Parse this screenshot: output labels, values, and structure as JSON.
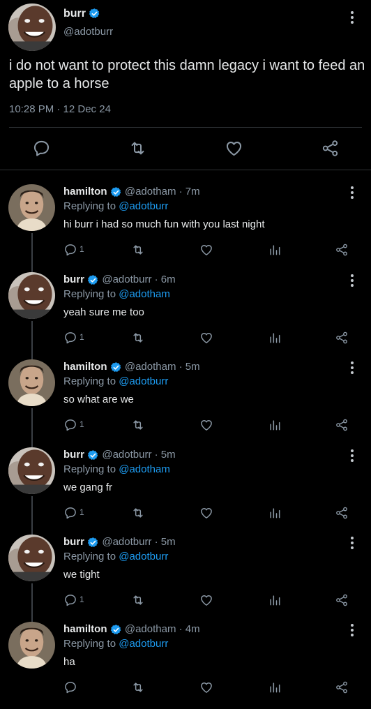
{
  "main_tweet": {
    "name": "burr",
    "handle": "@adotburr",
    "text": "i do not want to protect this damn legacy i want to feed an apple to a horse",
    "timestamp": "10:28 PM · 12 Dec 24"
  },
  "replies": [
    {
      "name": "hamilton",
      "handle": "@adotham",
      "time": "· 7m",
      "replying_prefix": "Replying to",
      "replying_to": "@adotburr",
      "text": "hi burr i had so much fun with you last night",
      "reply_count": "1"
    },
    {
      "name": "burr",
      "handle": "@adotburr",
      "time": "· 6m",
      "replying_prefix": "Replying to",
      "replying_to": "@adotham",
      "text": "yeah sure me too",
      "reply_count": "1"
    },
    {
      "name": "hamilton",
      "handle": "@adotham",
      "time": "· 5m",
      "replying_prefix": "Replying to",
      "replying_to": "@adotburr",
      "text": "so what are we",
      "reply_count": "1"
    },
    {
      "name": "burr",
      "handle": "@adotburr",
      "time": "· 5m",
      "replying_prefix": "Replying to",
      "replying_to": "@adotham",
      "text": "we gang fr",
      "reply_count": "1"
    },
    {
      "name": "burr",
      "handle": "@adotburr",
      "time": "· 5m",
      "replying_prefix": "Replying to",
      "replying_to": "@adotburr",
      "text": "we tight",
      "reply_count": "1"
    },
    {
      "name": "hamilton",
      "handle": "@adotham",
      "time": "· 4m",
      "replying_prefix": "Replying to",
      "replying_to": "@adotburr",
      "text": "ha",
      "reply_count": ""
    }
  ],
  "colors": {
    "background": "#000000",
    "accent": "#1d9bf0",
    "muted": "#8b98a5",
    "divider": "#2f3336"
  }
}
